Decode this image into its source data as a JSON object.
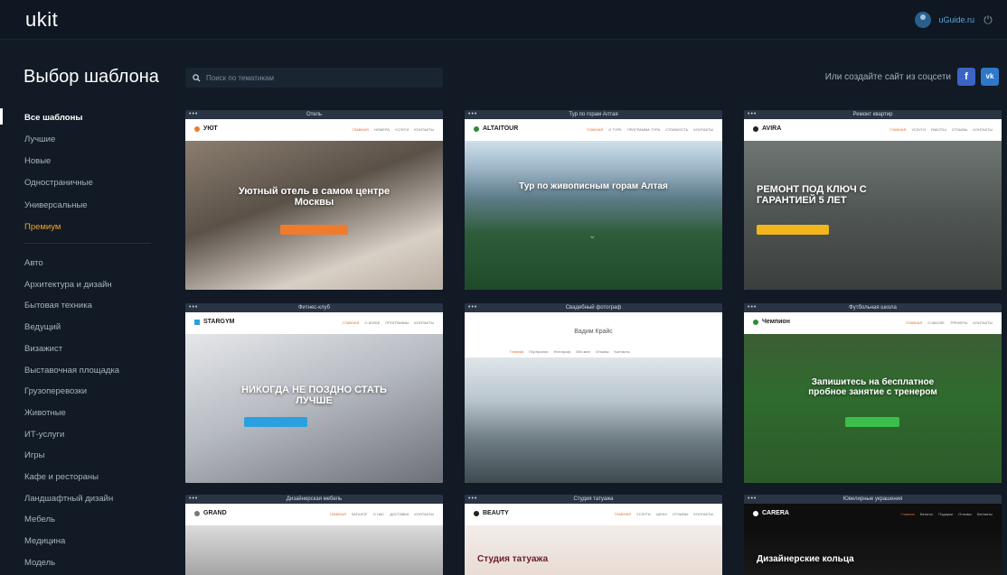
{
  "app": {
    "logo": "ukit",
    "username": "uGuide.ru"
  },
  "page": {
    "title": "Выбор шаблона"
  },
  "search": {
    "placeholder": "Поиск по тематикам"
  },
  "social": {
    "prompt": "Или создайте сайт из соцсети",
    "fb": "f",
    "vk": "vk"
  },
  "sidebar": {
    "primary": [
      {
        "label": "Все шаблоны",
        "state": "active"
      },
      {
        "label": "Лучшие"
      },
      {
        "label": "Новые"
      },
      {
        "label": "Одностраничные"
      },
      {
        "label": "Универсальные"
      },
      {
        "label": "Премиум",
        "state": "premium"
      }
    ],
    "categories": [
      "Авто",
      "Архитектура и дизайн",
      "Бытовая техника",
      "Ведущий",
      "Визажист",
      "Выставочная площадка",
      "Грузоперевозки",
      "Животные",
      "ИТ-услуги",
      "Игры",
      "Кафе и рестораны",
      "Ландшафтный дизайн",
      "Мебель",
      "Медицина",
      "Модель"
    ]
  },
  "cards": [
    {
      "title": "Отель",
      "brand": "УЮТ",
      "hero": "Уютный отель в самом центре Москвы",
      "nav": [
        "ГЛАВНАЯ",
        "НОМЕРА",
        "УСЛУГИ",
        "КОНТАКТЫ"
      ]
    },
    {
      "title": "Тур по горам Алтая",
      "brand": "ALTAITOUR",
      "hero": "Тур по живописным горам Алтая",
      "nav": [
        "ГЛАВНАЯ",
        "О ТУРЕ",
        "ПРОГРАММА ТУРА",
        "СТОИМОСТЬ",
        "КОНТАКТЫ"
      ]
    },
    {
      "title": "Ремонт квартир",
      "brand": "AVIRA",
      "hero": "РЕМОНТ ПОД КЛЮЧ С ГАРАНТИЕЙ 5 ЛЕТ",
      "nav": [
        "ГЛАВНАЯ",
        "УСЛУГИ",
        "РАБОТЫ",
        "ОТЗЫВЫ",
        "КОНТАКТЫ"
      ]
    },
    {
      "title": "Фитнес-клуб",
      "brand": "STARGYM",
      "hero": "НИКОГДА НЕ ПОЗДНО СТАТЬ ЛУЧШЕ",
      "nav": [
        "ГЛАВНАЯ",
        "О КЛУБЕ",
        "ПРОГРАММЫ",
        "КОНТАКТЫ"
      ]
    },
    {
      "title": "Свадебный фотограф",
      "brand": "Вадим Крайс",
      "hero": "",
      "nav": [
        "Главная",
        "Портфолио",
        "Фотограф",
        "Обо мне",
        "Отзывы",
        "Контакты"
      ]
    },
    {
      "title": "Футбольная школа",
      "brand": "Чемпион",
      "hero": "Запишитесь на бесплатное пробное занятие с тренером",
      "nav": [
        "ГЛАВНАЯ",
        "О ШКОЛЕ",
        "ТРЕНЕРЫ",
        "КОНТАКТЫ"
      ]
    },
    {
      "title": "Дизайнерская мебель",
      "brand": "GRAND",
      "hero": "",
      "nav": [
        "ГЛАВНАЯ",
        "КАТАЛОГ",
        "О НАС",
        "ДОСТАВКА",
        "КОНТАКТЫ"
      ]
    },
    {
      "title": "Студия татуажа",
      "brand": "BEAUTY",
      "hero": "Студия татуажа",
      "nav": [
        "ГЛАВНАЯ",
        "УСЛУГИ",
        "ЦЕНЫ",
        "ОТЗЫВЫ",
        "КОНТАКТЫ"
      ]
    },
    {
      "title": "Ювелирные украшения",
      "brand": "CARERA",
      "hero": "Дизайнерские кольца",
      "nav": [
        "Главная",
        "Каталог",
        "Подарки",
        "Отзывы",
        "Контакты"
      ]
    }
  ],
  "colors": {
    "background": "#111a25",
    "accent": "#f0a42a",
    "link": "#5ea6d9",
    "cta_orange": "#f07b2c",
    "cta_green": "#3bbf4a"
  }
}
